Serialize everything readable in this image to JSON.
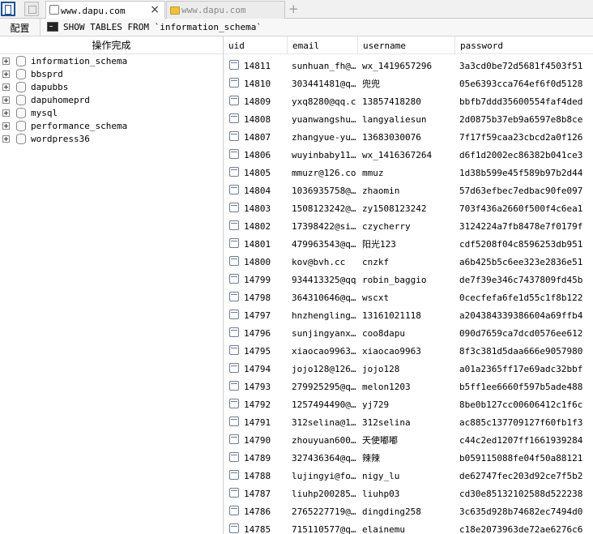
{
  "tabs": [
    {
      "label": "www.dapu.com",
      "active": true,
      "close": "×"
    },
    {
      "label": "www.dapu.com",
      "active": false
    }
  ],
  "new_tab": "+",
  "toolbar": {
    "config_label": "配置",
    "command": "SHOW TABLES FROM `information_schema`"
  },
  "left_panel": {
    "header": "操作完成",
    "databases": [
      "information_schema",
      "bbsprd",
      "dapubbs",
      "dapuhomeprd",
      "mysql",
      "performance_schema",
      "wordpress36"
    ]
  },
  "grid": {
    "columns": [
      "uid",
      "email",
      "username",
      "password"
    ],
    "rows": [
      {
        "uid": "14811",
        "email": "sunhuan_fh@…",
        "username": "wx_1419657296",
        "password": "3a3cd0be72d5681f4503f51…"
      },
      {
        "uid": "14810",
        "email": "303441481@q…",
        "username": "兜兜",
        "password": "05e6393cca764ef6f0d5128…"
      },
      {
        "uid": "14809",
        "email": "yxq8280@qq.com",
        "username": "13857418280",
        "password": "bbfb7ddd35600554faf4ded…"
      },
      {
        "uid": "14808",
        "email": "yuanwangshu…",
        "username": "langyaliesun",
        "password": "2d0875b37eb9a6597e8b8ce…"
      },
      {
        "uid": "14807",
        "email": "zhangyue-yu…",
        "username": "13683030076",
        "password": "7f17f59caa23cbcd2a0f126…"
      },
      {
        "uid": "14806",
        "email": "wuyinbaby11…",
        "username": "wx_1416367264",
        "password": "d6f1d2002ec86382b041ce3…"
      },
      {
        "uid": "14805",
        "email": "mmuzr@126.com",
        "username": "mmuz",
        "password": "1d38b599e45f589b97b2d44…"
      },
      {
        "uid": "14804",
        "email": "1036935758@…",
        "username": "zhaomin",
        "password": "57d63efbec7edbac90fe097…"
      },
      {
        "uid": "14803",
        "email": "1508123242@…",
        "username": "zy1508123242",
        "password": "703f436a2660f500f4c6ea1…"
      },
      {
        "uid": "14802",
        "email": "17398422@si…",
        "username": "czycherry",
        "password": "3124224a7fb8478e7f0179f…"
      },
      {
        "uid": "14801",
        "email": "479963543@q…",
        "username": "阳光123",
        "password": "cdf5208f04c8596253db951…"
      },
      {
        "uid": "14800",
        "email": "kov@bvh.cc",
        "username": "cnzkf",
        "password": "a6b425b5c6ee323e2836e51…"
      },
      {
        "uid": "14799",
        "email": "934413325@qq…",
        "username": "robin_baggio",
        "password": "de7f39e346c7437809fd45b…"
      },
      {
        "uid": "14798",
        "email": "364310646@q…",
        "username": "wscxt",
        "password": "0cecfefa6fe1d55c1f8b122…"
      },
      {
        "uid": "14797",
        "email": "hnzhengling…",
        "username": "13161021118",
        "password": "a204384339386604a69ffb4…"
      },
      {
        "uid": "14796",
        "email": "sunjingyanx…",
        "username": "coo8dapu",
        "password": "090d7659ca7dcd0576ee612…"
      },
      {
        "uid": "14795",
        "email": "xiaocao9963…",
        "username": "xiaocao9963",
        "password": "8f3c381d5daa666e9057980…"
      },
      {
        "uid": "14794",
        "email": "jojo128@126…",
        "username": "jojo128",
        "password": "a01a2365ff17e69adc32bbf…"
      },
      {
        "uid": "14793",
        "email": "279925295@q…",
        "username": "melon1203",
        "password": "b5ff1ee6660f597b5ade488…"
      },
      {
        "uid": "14792",
        "email": "1257494490@…",
        "username": "yj729",
        "password": "8be0b127cc00606412c1f6c…"
      },
      {
        "uid": "14791",
        "email": "312selina@1…",
        "username": "312selina",
        "password": "ac885c137709127f60fb1f3…"
      },
      {
        "uid": "14790",
        "email": "zhouyuan600…",
        "username": "天使嘟嘟",
        "password": "c44c2ed1207ff1661939284…"
      },
      {
        "uid": "14789",
        "email": "327436364@q…",
        "username": "辣辣",
        "password": "b059115088fe04f50a88121…"
      },
      {
        "uid": "14788",
        "email": "lujingyi@fo…",
        "username": "nigy_lu",
        "password": "de62747fec203d92ce7f5b2…"
      },
      {
        "uid": "14787",
        "email": "liuhp200285…",
        "username": "liuhp03",
        "password": "cd30e85132102588d522238…"
      },
      {
        "uid": "14786",
        "email": "2765227719@…",
        "username": "dingding258",
        "password": "3c635d928b74682ec7494d0…"
      },
      {
        "uid": "14785",
        "email": "715110577@q…",
        "username": "elainemu",
        "password": "c18e2073963de72ae6276c6…"
      }
    ]
  }
}
